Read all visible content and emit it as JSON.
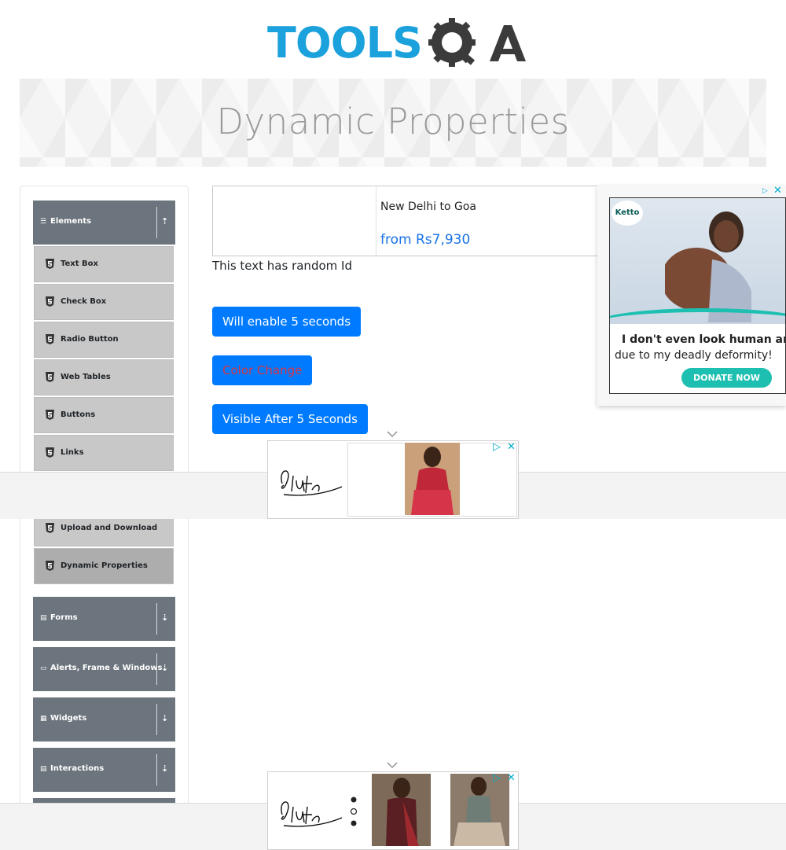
{
  "logo": {
    "text": "TOOLS",
    "qa": "QA"
  },
  "banner": {
    "title": "Dynamic Properties"
  },
  "sidebar": {
    "elements_header": "Elements",
    "items": [
      {
        "label": "Text Box"
      },
      {
        "label": "Check Box"
      },
      {
        "label": "Radio Button"
      },
      {
        "label": "Web Tables"
      },
      {
        "label": "Buttons"
      },
      {
        "label": "Links"
      },
      {
        "label": "Upload and Download"
      },
      {
        "label": "Dynamic Properties",
        "active": true
      }
    ],
    "groups": [
      {
        "label": "Forms"
      },
      {
        "label": "Alerts, Frame & Windows"
      },
      {
        "label": "Widgets"
      },
      {
        "label": "Interactions"
      }
    ]
  },
  "main": {
    "flight_ad": {
      "route": "New Delhi to Goa",
      "price": "from Rs7,930"
    },
    "random_text": "This text has random Id",
    "buttons": {
      "enable": "Will enable 5 seconds",
      "color_change": "Color Change",
      "visible_after": "Visible After 5 Seconds"
    }
  },
  "right_ad": {
    "brand": "Ketto",
    "headline1": "I don't even look human an",
    "headline2": "due to my deadly deformity!",
    "cta": "DONATE NOW"
  },
  "colors": {
    "primary": "#007bff",
    "danger": "#dc3545",
    "sidebar": "#6c757d",
    "accent": "#1ba1db"
  }
}
